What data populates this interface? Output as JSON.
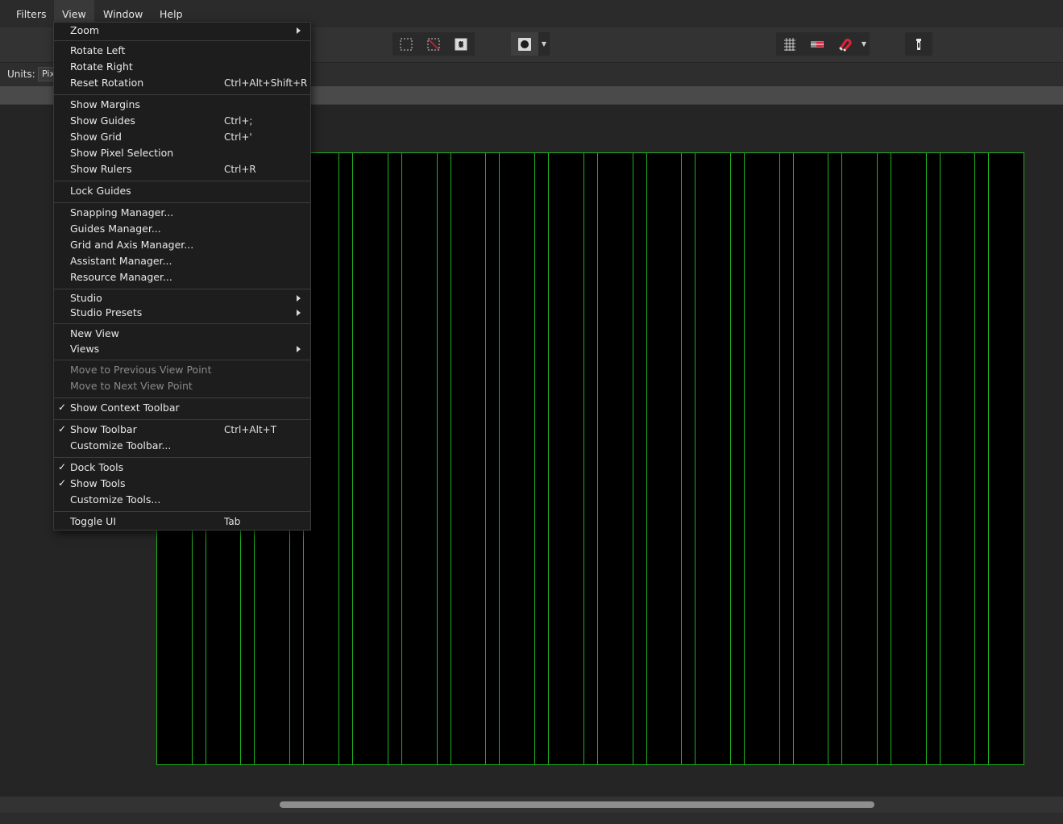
{
  "menubar": {
    "items": [
      {
        "label": "Filters"
      },
      {
        "label": "View"
      },
      {
        "label": "Window"
      },
      {
        "label": "Help"
      }
    ]
  },
  "context_toolbar": {
    "units_label": "Units:",
    "units_value": "Pix"
  },
  "toolbar": {
    "icons": [
      "marquee-selection-icon",
      "clear-selection-icon",
      "invert-selection-icon",
      "circle-brush-icon",
      "grid-icon",
      "guides-icon",
      "snapping-magnet-icon",
      "assistant-icon"
    ]
  },
  "colors": {
    "accent_red": "#e0223a",
    "guide_green": "#1fb21f",
    "menu_bg": "#1d1d1d"
  },
  "view_menu": {
    "zoom": "Zoom",
    "rotate_left": "Rotate Left",
    "rotate_right": "Rotate Right",
    "reset_rotation": "Reset Rotation",
    "reset_rotation_sc": "Ctrl+Alt+Shift+R",
    "show_margins": "Show Margins",
    "show_guides": "Show Guides",
    "show_guides_sc": "Ctrl+;",
    "show_grid": "Show Grid",
    "show_grid_sc": "Ctrl+'",
    "show_pixel_selection": "Show Pixel Selection",
    "show_rulers": "Show Rulers",
    "show_rulers_sc": "Ctrl+R",
    "lock_guides": "Lock Guides",
    "snapping_manager": "Snapping Manager...",
    "guides_manager": "Guides Manager...",
    "grid_axis_manager": "Grid and Axis Manager...",
    "assistant_manager": "Assistant Manager...",
    "resource_manager": "Resource Manager...",
    "studio": "Studio",
    "studio_presets": "Studio Presets",
    "new_view": "New View",
    "views": "Views",
    "move_prev": "Move to Previous View Point",
    "move_next": "Move to Next View Point",
    "show_context_toolbar": "Show Context Toolbar",
    "show_toolbar": "Show Toolbar",
    "show_toolbar_sc": "Ctrl+Alt+T",
    "customize_toolbar": "Customize Toolbar...",
    "dock_tools": "Dock Tools",
    "show_tools": "Show Tools",
    "customize_tools": "Customize Tools...",
    "toggle_ui": "Toggle UI",
    "toggle_ui_sc": "Tab",
    "checkmark": "✓"
  }
}
